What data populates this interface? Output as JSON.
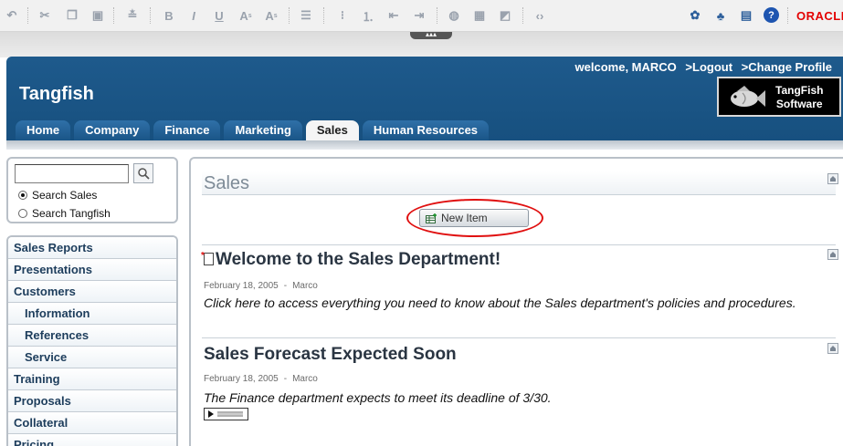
{
  "header": {
    "welcome_text": "welcome, MARCO",
    "logout_label": ">Logout",
    "profile_label": ">Change Profile",
    "site_title": "Tangfish",
    "logo_line1": "TangFish",
    "logo_line2": "Software"
  },
  "toolbar": {
    "brand": "ORACLE",
    "superscript": "A",
    "subscript": "A"
  },
  "tabs": [
    {
      "label": "Home"
    },
    {
      "label": "Company"
    },
    {
      "label": "Finance"
    },
    {
      "label": "Marketing"
    },
    {
      "label": "Sales"
    },
    {
      "label": "Human Resources"
    }
  ],
  "active_tab": "Sales",
  "search": {
    "value": "",
    "option_sales": "Search Sales",
    "option_site": "Search Tangfish",
    "selected": "Search Sales"
  },
  "sidebar": {
    "items": [
      {
        "label": "Sales Reports"
      },
      {
        "label": "Presentations"
      },
      {
        "label": "Customers"
      },
      {
        "label": "Information"
      },
      {
        "label": "References"
      },
      {
        "label": "Service"
      },
      {
        "label": "Training"
      },
      {
        "label": "Proposals"
      },
      {
        "label": "Collateral"
      },
      {
        "label": "Pricing"
      }
    ]
  },
  "main": {
    "title": "Sales",
    "new_item_label": "New Item",
    "posts": [
      {
        "title": "Welcome to the Sales Department!",
        "date": "February 18, 2005",
        "author": "Marco",
        "body": "Click here to access everything you need to know about the Sales department's policies and procedures."
      },
      {
        "title": "Sales Forecast Expected Soon",
        "date": "February 18, 2005",
        "author": "Marco",
        "body": "The Finance department expects to meet its deadline of 3/30."
      }
    ]
  },
  "colors": {
    "header_blue": "#1e5a8c",
    "oracle_red": "#e30000",
    "highlight_red": "#e01010"
  }
}
